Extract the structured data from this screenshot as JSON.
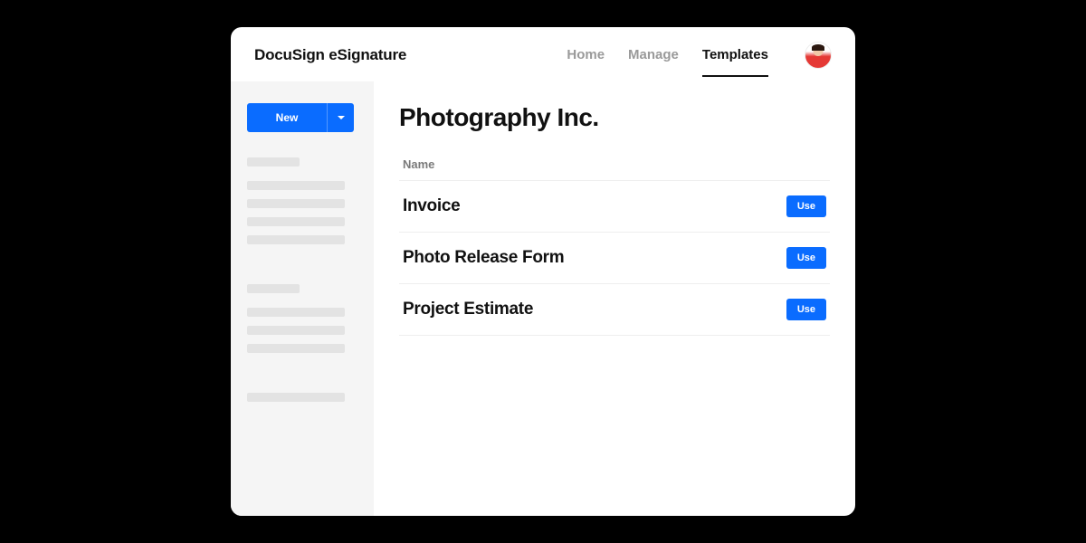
{
  "brand": "DocuSign eSignature",
  "nav": {
    "items": [
      {
        "label": "Home",
        "active": false
      },
      {
        "label": "Manage",
        "active": false
      },
      {
        "label": "Templates",
        "active": true
      }
    ]
  },
  "sidebar": {
    "new_button_label": "New"
  },
  "main": {
    "title": "Photography Inc.",
    "column_header": "Name",
    "use_button_label": "Use",
    "templates": [
      {
        "name": "Invoice"
      },
      {
        "name": "Photo Release Form"
      },
      {
        "name": "Project Estimate"
      }
    ]
  },
  "colors": {
    "primary_blue": "#0a6cff"
  }
}
